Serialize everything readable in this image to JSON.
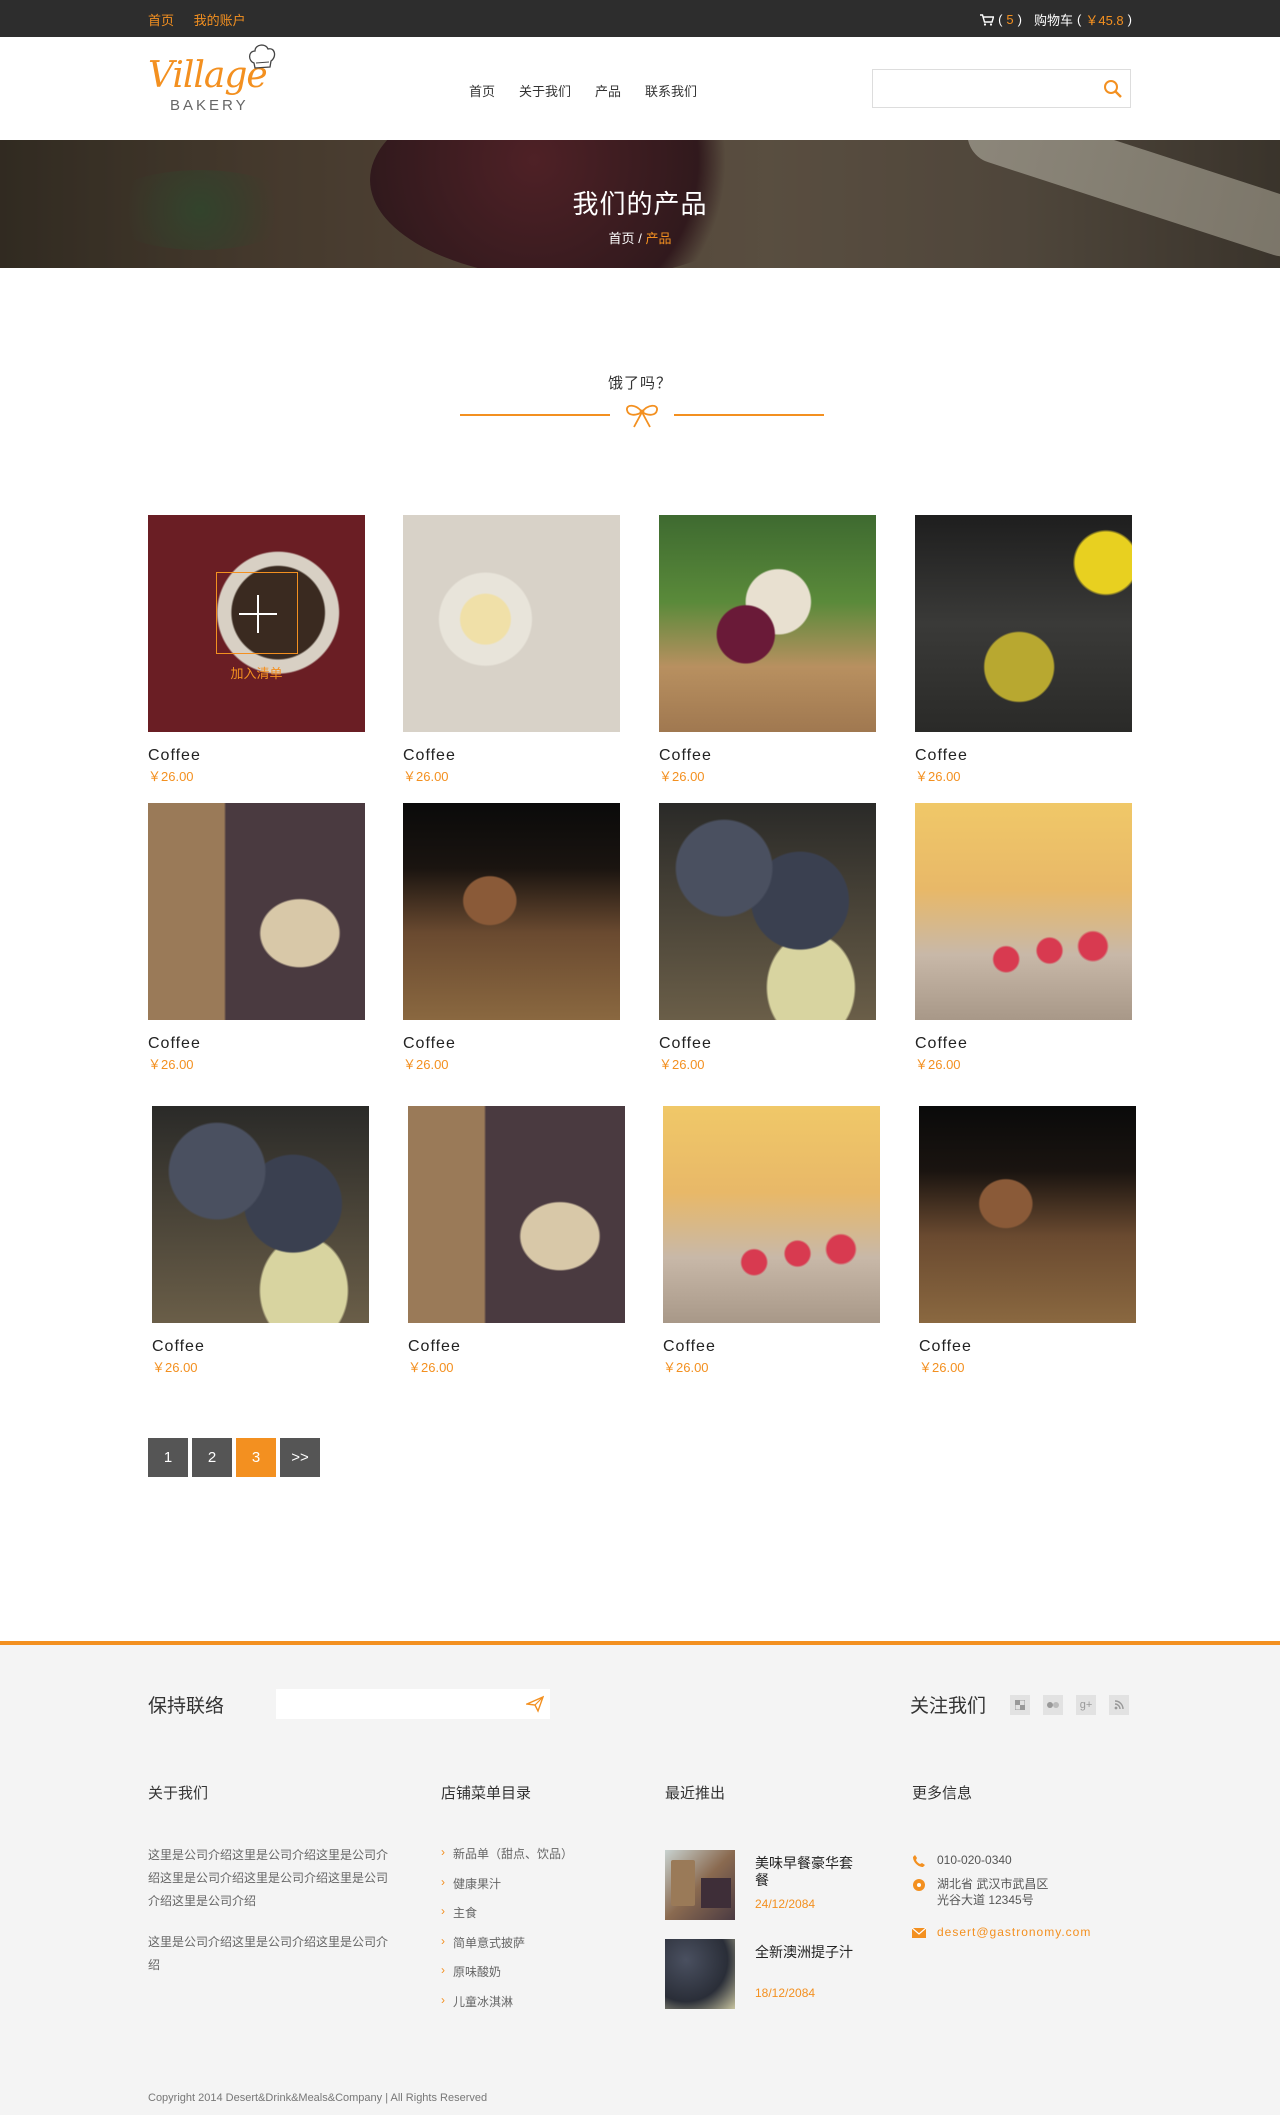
{
  "topbar": {
    "links": [
      "首页",
      "我的账户"
    ],
    "cart_count": "5",
    "cart_label": "购物车",
    "cart_total": "￥45.8"
  },
  "header": {
    "logo_script": "Village",
    "logo_sub": "BAKERY",
    "nav": [
      "首页",
      "关于我们",
      "产品",
      "联系我们"
    ],
    "search_placeholder": ""
  },
  "banner": {
    "title": "我们的产品",
    "crumb_home": "首页",
    "crumb_sep": "/",
    "crumb_current": "产品"
  },
  "section": {
    "title": "饿了吗？"
  },
  "products": [
    {
      "name": "Coffee",
      "price": "￥26.00",
      "overlay_label": "加入清单"
    },
    {
      "name": "Coffee",
      "price": "￥26.00"
    },
    {
      "name": "Coffee",
      "price": "￥26.00"
    },
    {
      "name": "Coffee",
      "price": "￥26.00"
    },
    {
      "name": "Coffee",
      "price": "￥26.00"
    },
    {
      "name": "Coffee",
      "price": "￥26.00"
    },
    {
      "name": "Coffee",
      "price": "￥26.00"
    },
    {
      "name": "Coffee",
      "price": "￥26.00"
    },
    {
      "name": "Coffee",
      "price": "￥26.00"
    },
    {
      "name": "Coffee",
      "price": "￥26.00"
    },
    {
      "name": "Coffee",
      "price": "￥26.00"
    },
    {
      "name": "Coffee",
      "price": "￥26.00"
    }
  ],
  "pagination": [
    "1",
    "2",
    "3",
    ">>"
  ],
  "pagination_active": "3",
  "footer": {
    "contact_title": "保持联络",
    "email_placeholder": "",
    "follow_title": "关注我们",
    "social_icons": [
      "delicious-icon",
      "flickr-icon",
      "google-plus-icon",
      "rss-icon"
    ],
    "col_about": "关于我们",
    "col_menu": "店铺菜单目录",
    "col_recent": "最近推出",
    "col_info": "更多信息",
    "about_p1": "这里是公司介绍这里是公司介绍这里是公司介绍这里是公司介绍这里是公司介绍这里是公司介绍这里是公司介绍",
    "about_p2": "这里是公司介绍这里是公司介绍这里是公司介绍",
    "menu_items": [
      "新品单（甜点、饮品）",
      "健康果汁",
      "主食",
      "简单意式披萨",
      "原味酸奶",
      "儿童冰淇淋"
    ],
    "recent": [
      {
        "title": "美味早餐豪华套餐",
        "date": "24/12/2084"
      },
      {
        "title": "全新澳洲提子汁",
        "date": "18/12/2084"
      }
    ],
    "phone": "010-020-0340",
    "address_line1": "湖北省 武汉市武昌区",
    "address_line2": "光谷大道 12345号",
    "email": "desert@gastronomy.com",
    "copyright": "Copyright 2014 Desert&Drink&Meals&Company | All Rights Reserved"
  },
  "colors": {
    "accent": "#f39020",
    "dark": "#2d2d2d",
    "footer_bg": "#f4f4f4"
  }
}
